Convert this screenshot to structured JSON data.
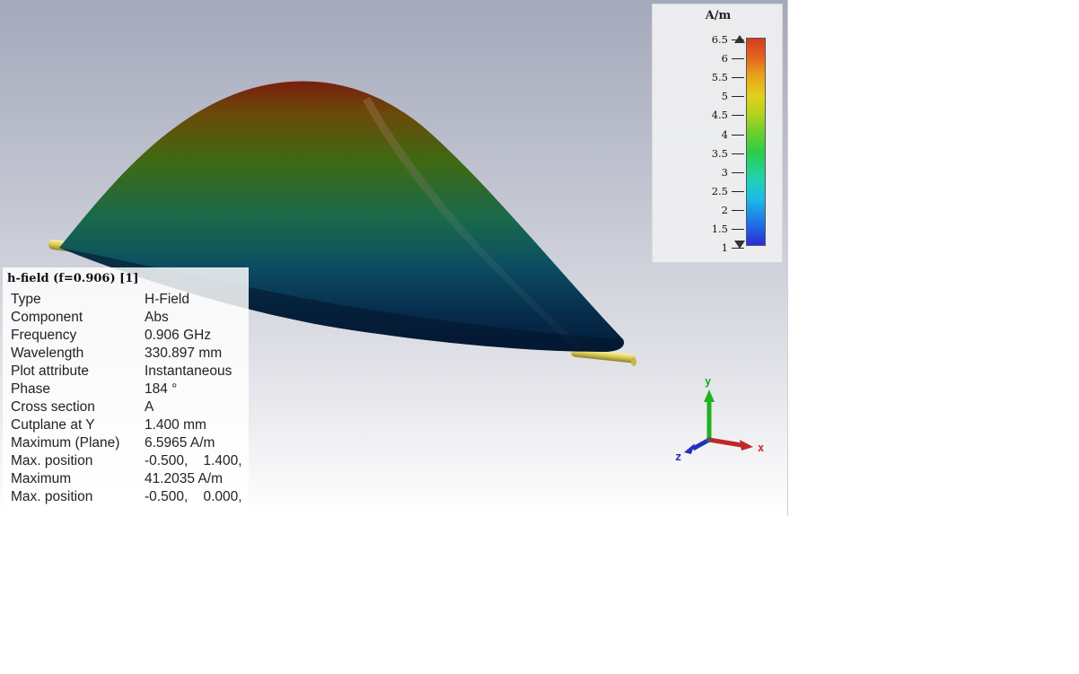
{
  "legend": {
    "unit": "A/m",
    "ticks": [
      "6.5",
      "6",
      "5.5",
      "5",
      "4.5",
      "4",
      "3.5",
      "3",
      "2.5",
      "2",
      "1.5",
      "1"
    ],
    "max_value": 6.5,
    "min_value": 1,
    "colors": {
      "low": "#2b2bd6",
      "high": "#d83a1e"
    }
  },
  "info": {
    "title": "h-field (f=0.906)  [1]",
    "rows": [
      {
        "key": "Type",
        "value": "H-Field"
      },
      {
        "key": "Component",
        "value": "Abs"
      },
      {
        "key": "Frequency",
        "value": "0.906 GHz"
      },
      {
        "key": "Wavelength",
        "value": "330.897 mm"
      },
      {
        "key": "Plot attribute",
        "value": "Instantaneous"
      },
      {
        "key": "Phase",
        "value": "184 °"
      },
      {
        "key": "Cross section",
        "value": "A"
      },
      {
        "key": "Cutplane at Y",
        "value": "1.400 mm"
      },
      {
        "key": "Maximum (Plane)",
        "value": "6.5965 A/m"
      },
      {
        "key": "Max. position",
        "value": "-0.500,    1.400,"
      },
      {
        "key": "Maximum",
        "value": "41.2035 A/m"
      },
      {
        "key": "Max. position",
        "value": "-0.500,    0.000,"
      }
    ]
  },
  "axes": {
    "x_label": "x",
    "y_label": "y",
    "z_label": "z",
    "x_color": "#e02020",
    "y_color": "#20b020",
    "z_color": "#2030c0"
  }
}
